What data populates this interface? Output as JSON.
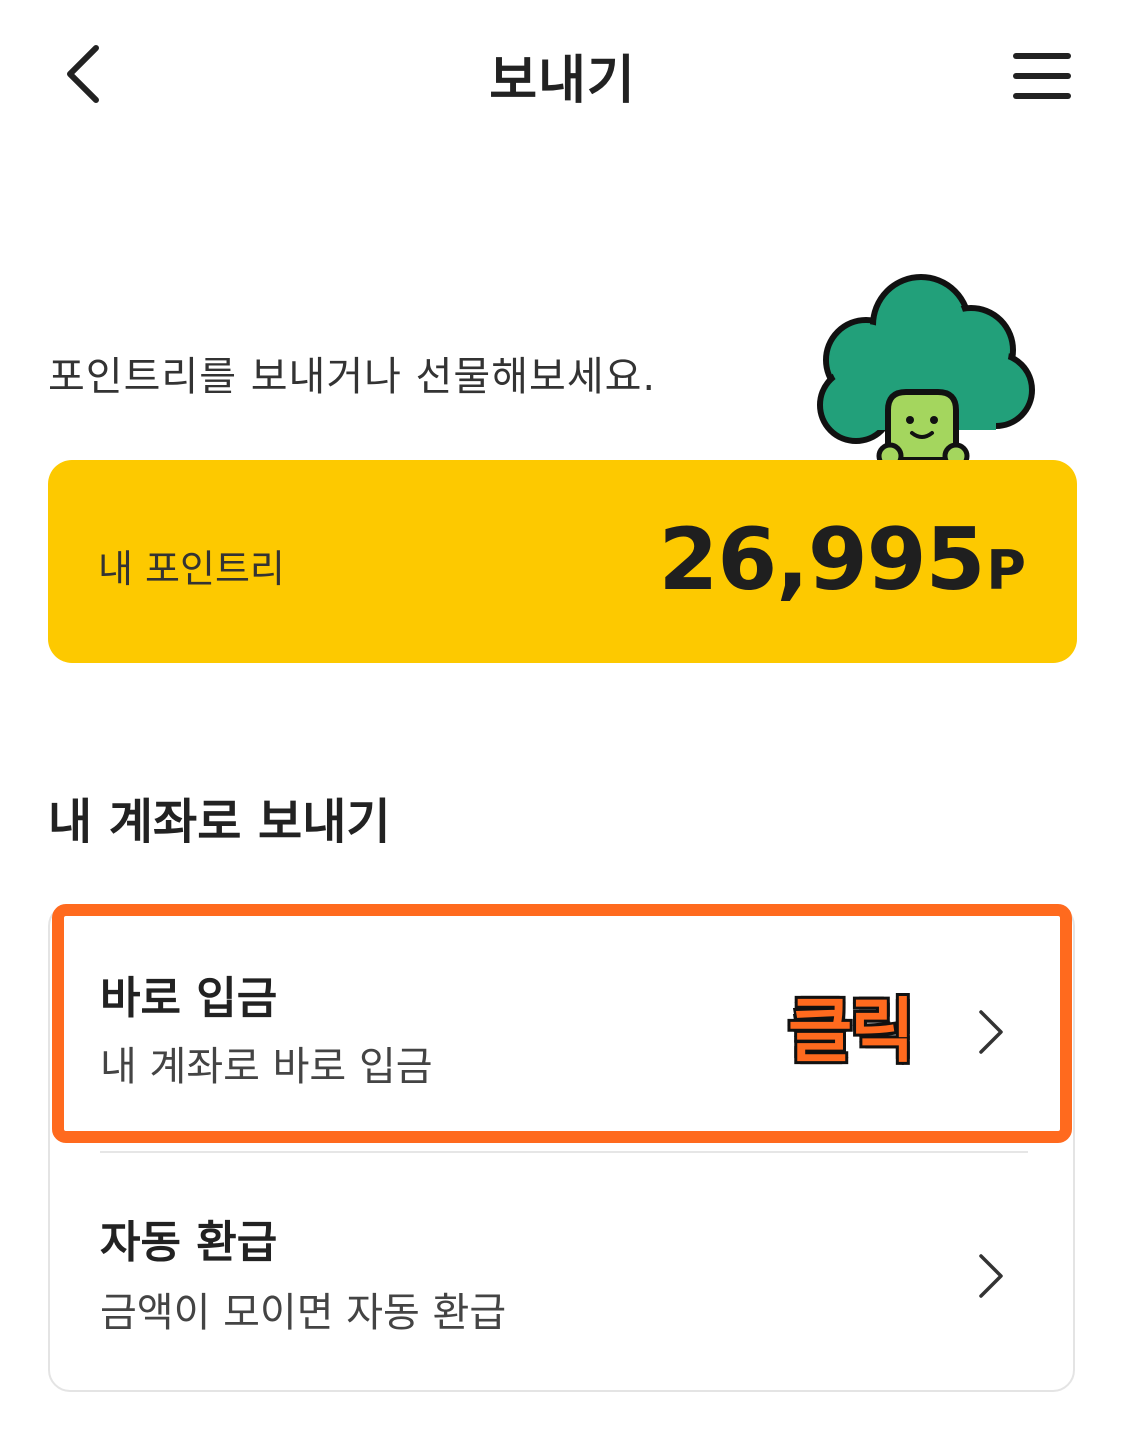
{
  "header": {
    "title": "보내기",
    "back_icon": "chevron-left-icon",
    "menu_icon": "hamburger-menu-icon"
  },
  "intro_text": "포인트리를 보내거나 선물해보세요.",
  "point_card": {
    "label": "내 포인트리",
    "amount": "26,995",
    "unit": "P",
    "color": "#fdc900"
  },
  "section_title": "내 계좌로 보내기",
  "options": [
    {
      "title": "바로 입금",
      "description": "내 계좌로 바로 입금",
      "icon": "chevron-right-icon"
    },
    {
      "title": "자동 환급",
      "description": "금액이 모이면 자동 환급",
      "icon": "chevron-right-icon"
    }
  ],
  "annotation": {
    "label": "클릭",
    "color": "#ff6a1e"
  }
}
